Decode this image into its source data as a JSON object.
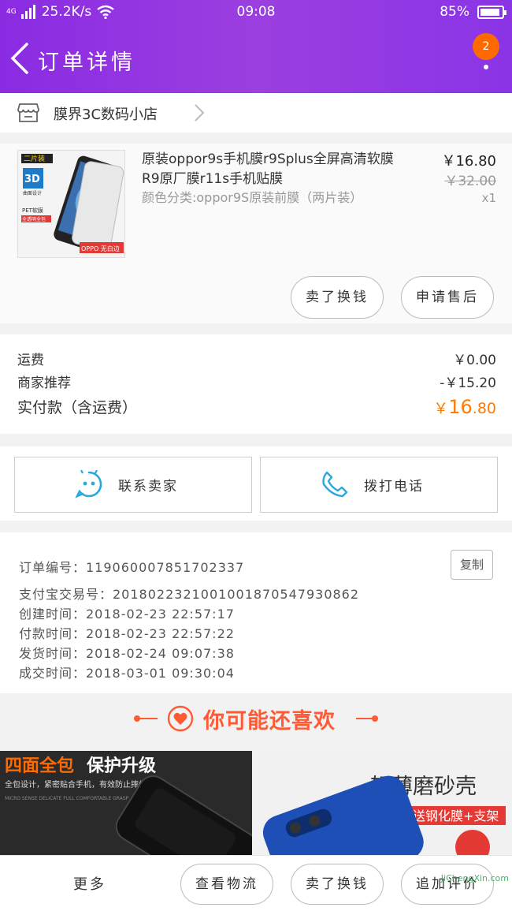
{
  "status": {
    "network": "4G",
    "speed": "25.2K/s",
    "time": "09:08",
    "battery": "85%"
  },
  "header": {
    "title": "订单详情",
    "badge_count": "2"
  },
  "shop": {
    "name": "膜界3C数码小店"
  },
  "product": {
    "name": "原装oppor9s手机膜r9Splus全屏高清软膜R9原厂膜r11s手机贴膜",
    "spec": "颜色分类:oppor9S原装前膜（两片装）",
    "price": "￥16.80",
    "original_price": "￥32.00",
    "quantity": "x1",
    "thumb_tag1": "二片装",
    "thumb_tag2": "3D",
    "thumb_tag3": "曲面设计",
    "thumb_tag4": "PET软膜",
    "thumb_tag5": "全透明全包",
    "thumb_tag6": "OPPO 无白边",
    "btn_resell": "卖了换钱",
    "btn_aftersale": "申请售后"
  },
  "costs": {
    "shipping_label": "运费",
    "shipping_value": "￥0.00",
    "recommend_label": "商家推荐",
    "recommend_value": "-￥15.20",
    "paid_label": "实付款（含运费）",
    "paid_currency": "￥",
    "paid_int": "16",
    "paid_dec": ".80"
  },
  "contacts": {
    "seller": "联系卖家",
    "phone": "拨打电话"
  },
  "order": {
    "number": "订单编号：119060007851702337",
    "alipay": "支付宝交易号：2018022321001001870547930862",
    "created": "创建时间：2018-02-23 22:57:17",
    "paid": "付款时间：2018-02-23 22:57:22",
    "shipped": "发货时间：2018-02-24 09:07:38",
    "completed": "成交时间：2018-03-01 09:30:04",
    "copy": "复制"
  },
  "recommend": {
    "title": "你可能还喜欢",
    "card1_title_a": "四面全包",
    "card1_title_b": "保护升级",
    "card1_sub": "全包设计，紧密贴合手机，有效防止摔伤",
    "card1_sub2": "MICRO SENSE DELICATE FULL COMFORTABLE GRASP",
    "card2_title": "轻薄磨砂壳",
    "card2_tag": "送钢化膜+支架"
  },
  "bottombar": {
    "more": "更多",
    "logistics": "查看物流",
    "resell": "卖了换钱",
    "review": "追加评价",
    "watermark": "JiChengXin.com"
  },
  "colors": {
    "header": "#8a2be2",
    "accent": "#ff7a00",
    "recommend": "#ff5a36",
    "icon_blue": "#29a8e0"
  }
}
